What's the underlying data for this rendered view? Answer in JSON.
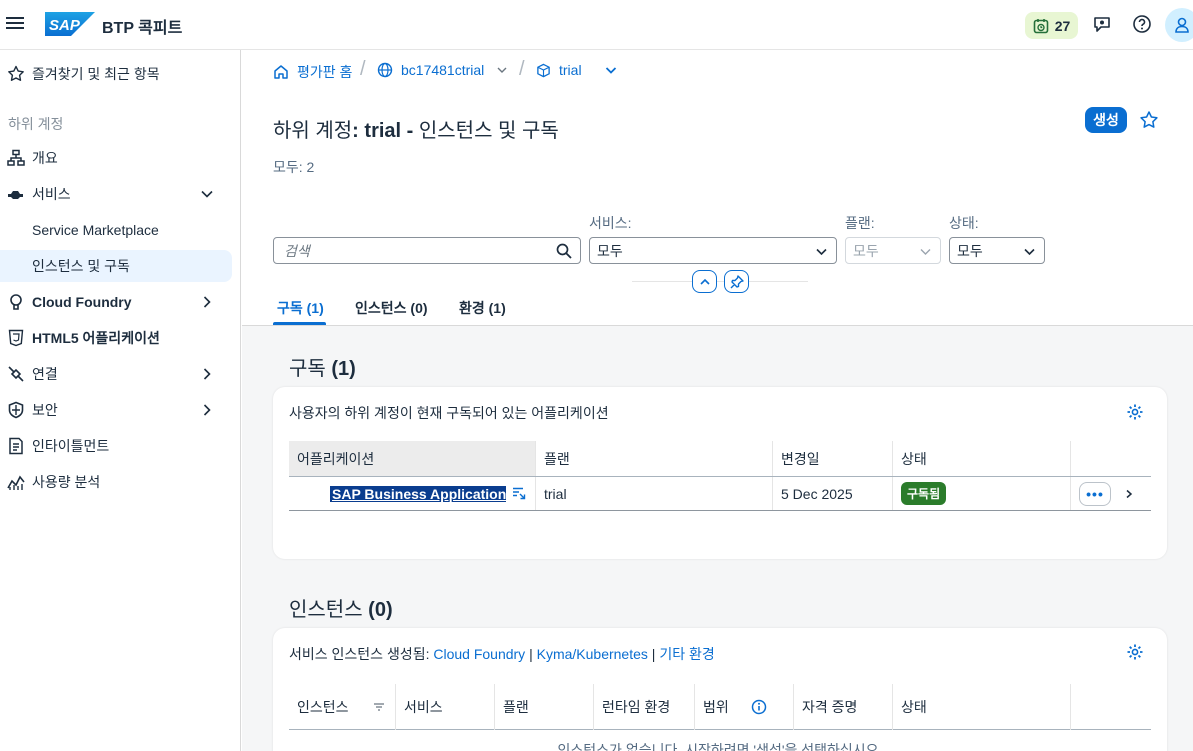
{
  "shell": {
    "product": "BTP 콕피트",
    "notifications_count": "27"
  },
  "sidebar": {
    "favorites": "즐겨찾기 및 최근 항목",
    "group": "하위 계정",
    "items": [
      {
        "label": "개요"
      },
      {
        "label": "서비스"
      },
      {
        "label": "Service Marketplace"
      },
      {
        "label": "인스턴스 및 구독"
      },
      {
        "label": "Cloud Foundry"
      },
      {
        "label": "HTML5 어플리케이션"
      },
      {
        "label": "연결"
      },
      {
        "label": "보안"
      },
      {
        "label": "인타이틀먼트"
      },
      {
        "label": "사용량 분석"
      }
    ]
  },
  "breadcrumb": {
    "home": "평가판 홈",
    "account": "bc17481ctrial",
    "subaccount": "trial"
  },
  "page": {
    "title_prefix": "하위 계정",
    "title_colon": ":",
    "title_name": "trial -",
    "title_suffix": "인스턴스 및 구독",
    "create_label": "생성",
    "count": "모두: 2"
  },
  "filters": {
    "search_placeholder": "검색",
    "service_label": "서비스:",
    "service_value": "모두",
    "plan_label": "플랜:",
    "plan_value": "모두",
    "status_label": "상태:",
    "status_value": "모두"
  },
  "tabs": [
    {
      "label": "구독 (1)"
    },
    {
      "label": "인스턴스 (0)"
    },
    {
      "label": "환경 (1)"
    }
  ],
  "subscriptions": {
    "title": "구독",
    "count": "(1)",
    "description": "사용자의 하위 계정이 현재 구독되어 있는 어플리케이션",
    "columns": [
      "어플리케이션",
      "플랜",
      "변경일",
      "상태"
    ],
    "rows": [
      {
        "app": "SAP Business Application ...",
        "plan": "trial",
        "changed": "5 Dec 2025",
        "status": "구독됨"
      }
    ]
  },
  "instances": {
    "title": "인스턴스",
    "count": "(0)",
    "desc_prefix": "서비스 인스턴스 생성됨:",
    "link_cf": "Cloud Foundry",
    "sep1": "|",
    "link_kyma": "Kyma/Kubernetes",
    "sep2": "|",
    "link_other": "기타 환경",
    "columns": [
      "인스턴스",
      "서비스",
      "플랜",
      "런타임 환경",
      "범위",
      "자격 증명",
      "상태"
    ],
    "empty": "인스턴스가 없습니다. 시작하려면 '생성'을 선택하십시오."
  },
  "colors": {
    "accent": "#0a6ed1",
    "success": "#2b7c2b",
    "badge_bg": "#e8f6d3"
  }
}
